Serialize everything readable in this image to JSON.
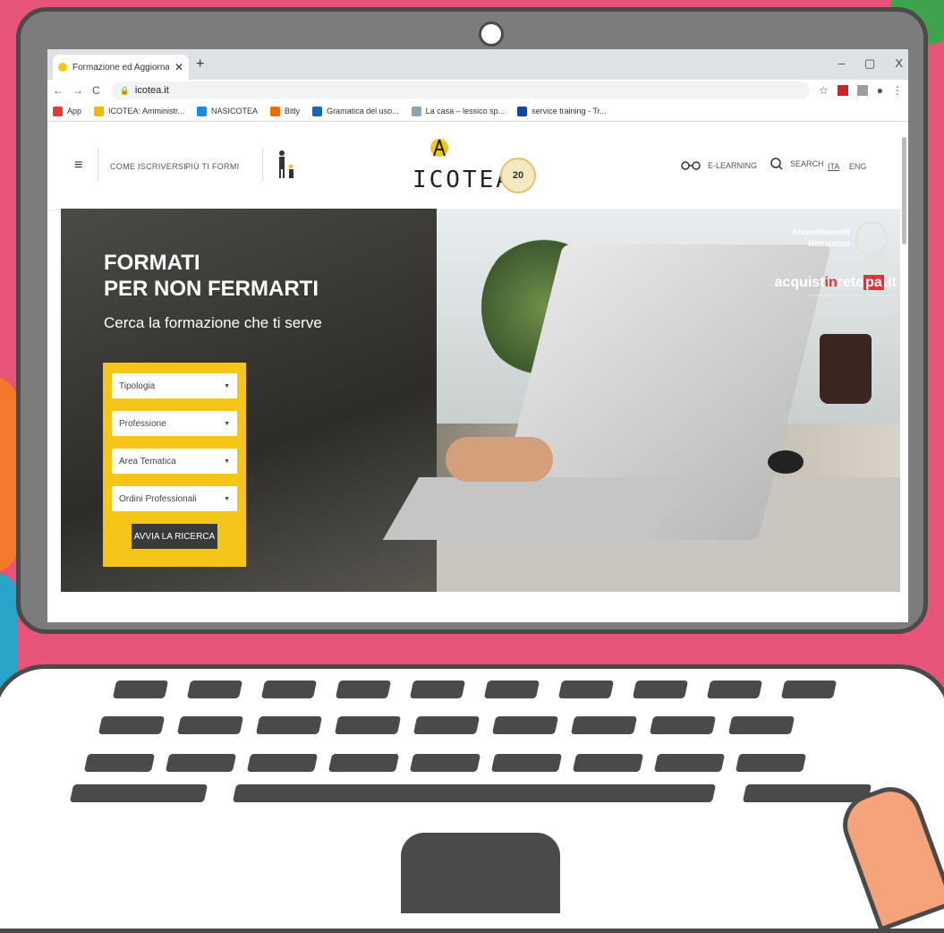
{
  "browser": {
    "tab_title": "Formazione ed Aggiornamento P",
    "new_tab": "+",
    "window_controls": [
      "–",
      "▢",
      "X"
    ],
    "url": "icotea.it",
    "bookmarks": [
      {
        "label": "App",
        "color": "#e53935"
      },
      {
        "label": "ICOTEA: Amministr...",
        "color": "#f5b800"
      },
      {
        "label": "NASICOTEA",
        "color": "#1e88e5"
      },
      {
        "label": "Bitly",
        "color": "#ef6c00"
      },
      {
        "label": "Gramatica del uso...",
        "color": "#1565c0"
      },
      {
        "label": "La casa – lessico sp...",
        "color": "#90a4ae"
      },
      {
        "label": "service training - Tr...",
        "color": "#0d47a1"
      }
    ]
  },
  "site": {
    "nav": {
      "how_to_enroll": "COME ISCRIVERSI",
      "more_training": "PIÙ TI FORMI",
      "elearning": "E-LEARNING",
      "search": "SEARCH",
      "lang_ita": "ITA",
      "lang_eng": "ENG"
    },
    "logo_text": "ICOTEA",
    "anniversary_badge": "20",
    "hero": {
      "title_line1": "FORMATI",
      "title_line2": "PER NON FERMARTI",
      "subtitle": "Cerca la formazione che ti serve",
      "selects": [
        "Tipologia",
        "Professione",
        "Area Tematica",
        "Ordini Professionali"
      ],
      "search_button": "AVVIA LA RICERCA",
      "accreditation_line1": "Accreditamenti",
      "accreditation_line2": "Ministeriali",
      "acq_pre": "acquist",
      "acq_in": "in",
      "acq_rete": "rete",
      "acq_pa": "pa",
      "acq_it": ".it",
      "acq_sub": "Il Portale degli acquisti della Pubblica Amministrazione"
    }
  },
  "colors": {
    "background": "#e8537a",
    "laptop_frame": "#7c7c7c",
    "accent_yellow": "#f5c518"
  }
}
